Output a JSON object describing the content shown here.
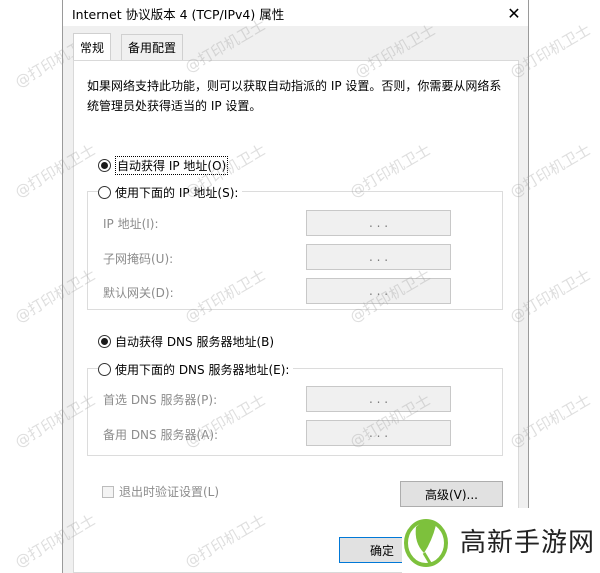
{
  "window": {
    "title": "Internet 协议版本 4 (TCP/IPv4) 属性",
    "close_glyph": "✕"
  },
  "tabs": [
    {
      "label": "常规",
      "active": true
    },
    {
      "label": "备用配置",
      "active": false
    }
  ],
  "description": "如果网络支持此功能，则可以获取自动指派的 IP 设置。否则，你需要从网络系统管理员处获得适当的 IP 设置。",
  "ip_section": {
    "auto_label": "自动获得 IP 地址(O)",
    "auto_selected": true,
    "manual_label": "使用下面的 IP 地址(S):",
    "manual_selected": false,
    "fields": [
      {
        "label": "IP 地址(I):",
        "value": ".     .     ."
      },
      {
        "label": "子网掩码(U):",
        "value": ".     .     ."
      },
      {
        "label": "默认网关(D):",
        "value": ".     .     ."
      }
    ]
  },
  "dns_section": {
    "auto_label": "自动获得 DNS 服务器地址(B)",
    "auto_selected": true,
    "manual_label": "使用下面的 DNS 服务器地址(E):",
    "manual_selected": false,
    "fields": [
      {
        "label": "首选 DNS 服务器(P):",
        "value": ".     .     ."
      },
      {
        "label": "备用 DNS 服务器(A):",
        "value": ".     .     ."
      }
    ]
  },
  "validate_checkbox": {
    "label": "退出时验证设置(L)",
    "checked": false,
    "enabled": false
  },
  "buttons": {
    "advanced": "高级(V)...",
    "ok": "确定"
  },
  "watermark_text": "@打印机卫士",
  "brand": {
    "name": "高新手游网"
  },
  "colors": {
    "accent": "#0078d7",
    "brand_green": "#7dc13c"
  }
}
